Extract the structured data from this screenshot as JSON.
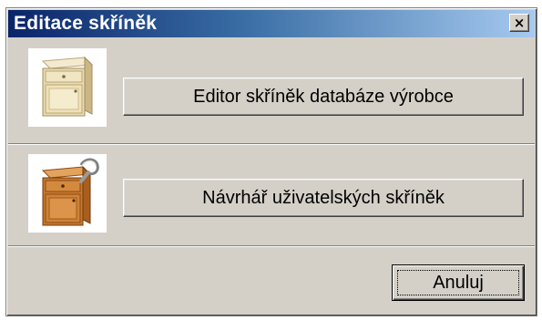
{
  "window": {
    "title": "Editace skříněk",
    "close_glyph": "×"
  },
  "options": [
    {
      "label": "Editor skříněk databáze výrobce",
      "icon": "cabinet-light-icon",
      "icon_color": "#e8d9a8"
    },
    {
      "label": "Návrhář uživatelských skříněk",
      "icon": "cabinet-design-icon",
      "icon_color": "#c7772a"
    }
  ],
  "footer": {
    "cancel_label": "Anuluj"
  },
  "colors": {
    "dialog_bg": "#d4d0c8",
    "title_start": "#0a246a",
    "title_end": "#a6caf0"
  }
}
